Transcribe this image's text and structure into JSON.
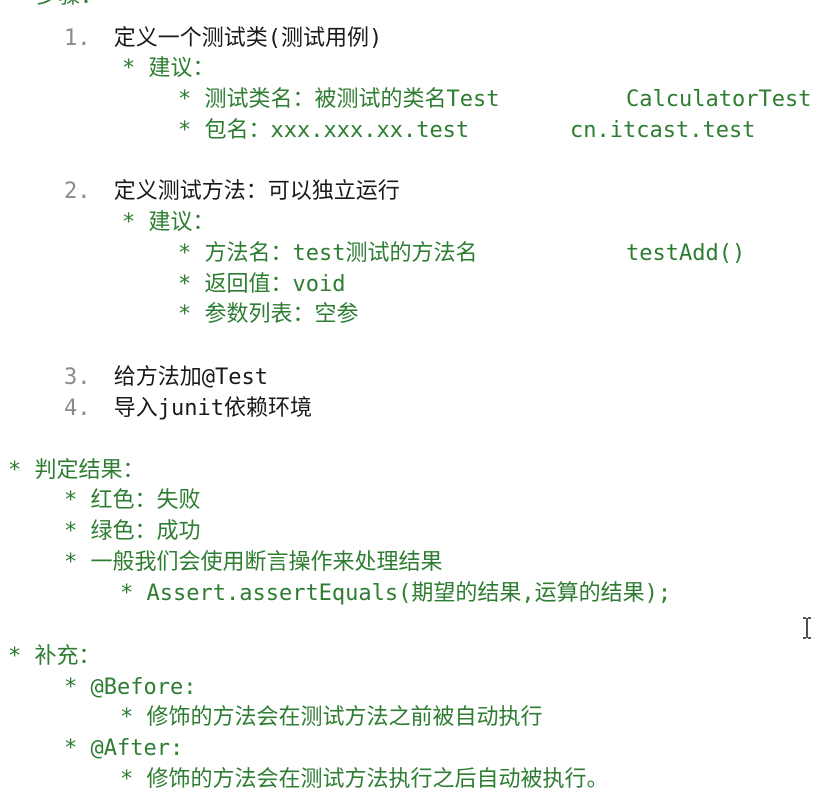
{
  "top_partial": "* 步骤：",
  "steps": [
    {
      "num": "1.",
      "text": "定义一个测试类(测试用例)",
      "advice": "* 建议：",
      "subs": [
        {
          "bullet": "*",
          "text": "测试类名：被测试的类名Test",
          "example": "CalculatorTest"
        },
        {
          "bullet": "*",
          "text": "包名：xxx.xxx.xx.test",
          "example": "cn.itcast.test"
        }
      ]
    },
    {
      "num": "2.",
      "text": "定义测试方法：可以独立运行",
      "advice": "* 建议：",
      "subs": [
        {
          "bullet": "*",
          "text": "方法名：test测试的方法名",
          "example": "testAdd()"
        },
        {
          "bullet": "*",
          "text": "返回值：void",
          "example": ""
        },
        {
          "bullet": "*",
          "text": "参数列表：空参",
          "example": ""
        }
      ]
    },
    {
      "num": "3.",
      "text": "给方法加@Test"
    },
    {
      "num": "4.",
      "text": "导入junit依赖环境"
    }
  ],
  "result": {
    "heading": "* 判定结果：",
    "items": [
      {
        "bullet": "*",
        "text": "红色：失败"
      },
      {
        "bullet": "*",
        "text": "绿色：成功"
      },
      {
        "bullet": "*",
        "text": "一般我们会使用断言操作来处理结果"
      }
    ],
    "sub": {
      "bullet": "*",
      "text": "Assert.assertEquals(期望的结果,运算的结果);"
    }
  },
  "supplement": {
    "heading": "* 补充：",
    "items": [
      {
        "bullet": "*",
        "text": "@Before:",
        "sub_bullet": "*",
        "sub": "修饰的方法会在测试方法之前被自动执行"
      },
      {
        "bullet": "*",
        "text": "@After:",
        "sub_bullet": "*",
        "sub": "修饰的方法会在测试方法执行之后自动被执行。"
      }
    ]
  },
  "cursor_icon": "text-cursor-icon"
}
